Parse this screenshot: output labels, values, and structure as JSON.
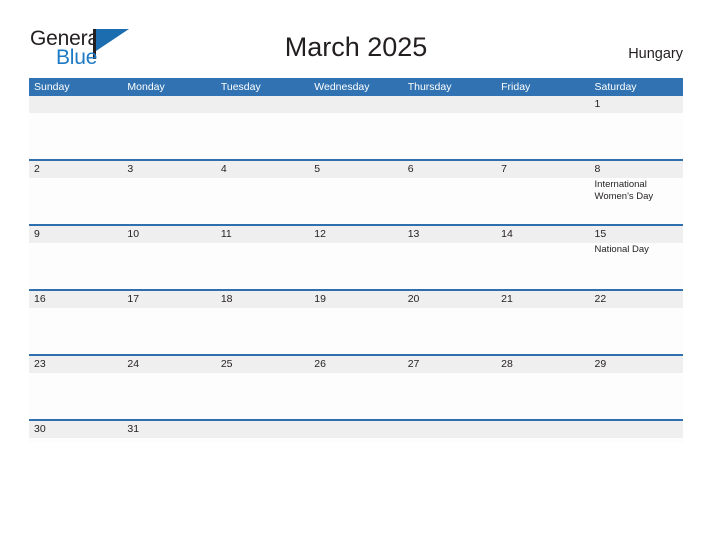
{
  "brand": {
    "name_part1": "General",
    "name_part2": "Blue",
    "flag_icon": "flag-icon"
  },
  "header": {
    "title": "March 2025",
    "country": "Hungary"
  },
  "calendar": {
    "weekdays": [
      "Sunday",
      "Monday",
      "Tuesday",
      "Wednesday",
      "Thursday",
      "Friday",
      "Saturday"
    ],
    "colors": {
      "header_blue": "#3173b2",
      "row_divider_blue": "#2f6fad",
      "day_band_gray": "#efefef",
      "cell_white": "#fdfdfd",
      "text_dark": "#231f20",
      "logo_blue": "#1e7ac4"
    },
    "weeks": [
      [
        {
          "date": "",
          "events": []
        },
        {
          "date": "",
          "events": []
        },
        {
          "date": "",
          "events": []
        },
        {
          "date": "",
          "events": []
        },
        {
          "date": "",
          "events": []
        },
        {
          "date": "",
          "events": []
        },
        {
          "date": "1",
          "events": []
        }
      ],
      [
        {
          "date": "2",
          "events": []
        },
        {
          "date": "3",
          "events": []
        },
        {
          "date": "4",
          "events": []
        },
        {
          "date": "5",
          "events": []
        },
        {
          "date": "6",
          "events": []
        },
        {
          "date": "7",
          "events": []
        },
        {
          "date": "8",
          "events": [
            "International Women's Day"
          ]
        }
      ],
      [
        {
          "date": "9",
          "events": []
        },
        {
          "date": "10",
          "events": []
        },
        {
          "date": "11",
          "events": []
        },
        {
          "date": "12",
          "events": []
        },
        {
          "date": "13",
          "events": []
        },
        {
          "date": "14",
          "events": []
        },
        {
          "date": "15",
          "events": [
            "National Day"
          ]
        }
      ],
      [
        {
          "date": "16",
          "events": []
        },
        {
          "date": "17",
          "events": []
        },
        {
          "date": "18",
          "events": []
        },
        {
          "date": "19",
          "events": []
        },
        {
          "date": "20",
          "events": []
        },
        {
          "date": "21",
          "events": []
        },
        {
          "date": "22",
          "events": []
        }
      ],
      [
        {
          "date": "23",
          "events": []
        },
        {
          "date": "24",
          "events": []
        },
        {
          "date": "25",
          "events": []
        },
        {
          "date": "26",
          "events": []
        },
        {
          "date": "27",
          "events": []
        },
        {
          "date": "28",
          "events": []
        },
        {
          "date": "29",
          "events": []
        }
      ],
      [
        {
          "date": "30",
          "events": []
        },
        {
          "date": "31",
          "events": []
        },
        {
          "date": "",
          "events": []
        },
        {
          "date": "",
          "events": []
        },
        {
          "date": "",
          "events": []
        },
        {
          "date": "",
          "events": []
        },
        {
          "date": "",
          "events": []
        }
      ]
    ]
  }
}
